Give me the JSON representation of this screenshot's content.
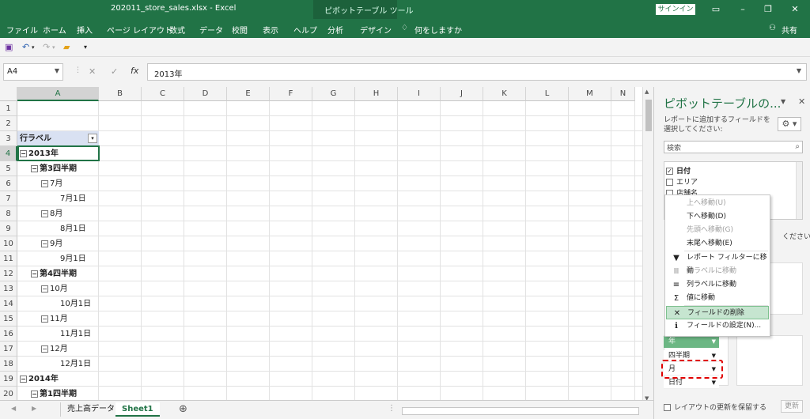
{
  "titlebar": {
    "document": "202011_store_sales.xlsx  -  Excel",
    "context_label": "ピボットテーブル ツール",
    "signin": "サインイン",
    "win_icons": [
      "ribbon-options-icon",
      "minimize-icon",
      "restore-icon",
      "close-icon"
    ]
  },
  "ribbon": {
    "tabs": [
      "ファイル",
      "ホーム",
      "挿入",
      "ページ レイアウト",
      "数式",
      "データ",
      "校閲",
      "表示",
      "ヘルプ",
      "分析",
      "デザイン"
    ],
    "tell_me": "何をしますか",
    "share": "共有"
  },
  "formula_bar": {
    "name_box": "A4",
    "cancel": "✕",
    "enter": "✓",
    "fx": "fx",
    "value": "2013年"
  },
  "columns": [
    "A",
    "B",
    "C",
    "D",
    "E",
    "F",
    "G",
    "H",
    "I",
    "J",
    "K",
    "L",
    "M",
    "N"
  ],
  "rows": [
    "1",
    "2",
    "3",
    "4",
    "5",
    "6",
    "7",
    "8",
    "9",
    "10",
    "11",
    "12",
    "13",
    "14",
    "15",
    "16",
    "17",
    "18",
    "19",
    "20"
  ],
  "pivot": {
    "header": "行ラベル",
    "items": [
      {
        "text": "2013年",
        "level": 0,
        "toggle": "⊟"
      },
      {
        "text": "第3四半期",
        "level": 1,
        "toggle": "⊟"
      },
      {
        "text": "7月",
        "level": 2,
        "toggle": "⊟"
      },
      {
        "text": "7月1日",
        "level": 3,
        "toggle": ""
      },
      {
        "text": "8月",
        "level": 2,
        "toggle": "⊟"
      },
      {
        "text": "8月1日",
        "level": 3,
        "toggle": ""
      },
      {
        "text": "9月",
        "level": 2,
        "toggle": "⊟"
      },
      {
        "text": "9月1日",
        "level": 3,
        "toggle": ""
      },
      {
        "text": "第4四半期",
        "level": 1,
        "toggle": "⊟"
      },
      {
        "text": "10月",
        "level": 2,
        "toggle": "⊟"
      },
      {
        "text": "10月1日",
        "level": 3,
        "toggle": ""
      },
      {
        "text": "11月",
        "level": 2,
        "toggle": "⊟"
      },
      {
        "text": "11月1日",
        "level": 3,
        "toggle": ""
      },
      {
        "text": "12月",
        "level": 2,
        "toggle": "⊟"
      },
      {
        "text": "12月1日",
        "level": 3,
        "toggle": ""
      },
      {
        "text": "2014年",
        "level": 0,
        "toggle": "⊟"
      },
      {
        "text": "第1四半期",
        "level": 1,
        "toggle": "⊟"
      }
    ]
  },
  "sheets": {
    "tabs": [
      "売上高データ",
      "Sheet1"
    ],
    "active": "Sheet1",
    "add": "⊕"
  },
  "pane": {
    "title": "ピボットテーブルの...",
    "description": "レポートに追加するフィールドを選択してください:",
    "search_placeholder": "検索",
    "fields": [
      {
        "label": "日付",
        "checked": true
      },
      {
        "label": "エリア",
        "checked": false
      },
      {
        "label": "店舗名",
        "checked": false
      }
    ],
    "drag_hint": "ください:",
    "row_fields": [
      "年",
      "四半期",
      "月",
      "日付"
    ],
    "defer_label": "レイアウトの更新を保留する",
    "update_label": "更新"
  },
  "context_menu": {
    "items": [
      {
        "label": "上へ移動(U)",
        "disabled": true,
        "icon": ""
      },
      {
        "label": "下へ移動(D)",
        "disabled": false,
        "icon": ""
      },
      {
        "label": "先頭へ移動(G)",
        "disabled": true,
        "icon": ""
      },
      {
        "label": "末尾へ移動(E)",
        "disabled": false,
        "icon": ""
      },
      {
        "label": "レポート フィルターに移動",
        "disabled": false,
        "icon": "filter-icon"
      },
      {
        "label": "行ラベルに移動",
        "disabled": true,
        "icon": "rows-icon"
      },
      {
        "label": "列ラベルに移動",
        "disabled": false,
        "icon": "columns-icon"
      },
      {
        "label": "値に移動",
        "disabled": false,
        "icon": "sigma-icon"
      },
      {
        "label": "フィールドの削除",
        "disabled": false,
        "highlighted": true,
        "icon": "delete-x-icon"
      },
      {
        "label": "フィールドの設定(N)...",
        "disabled": false,
        "icon": "field-settings-icon"
      }
    ]
  },
  "colors": {
    "excel_green": "#217346",
    "highlight": "#c6e5d0",
    "dashed_red": "#e00000",
    "pivot_header": "#d9e1f2"
  }
}
